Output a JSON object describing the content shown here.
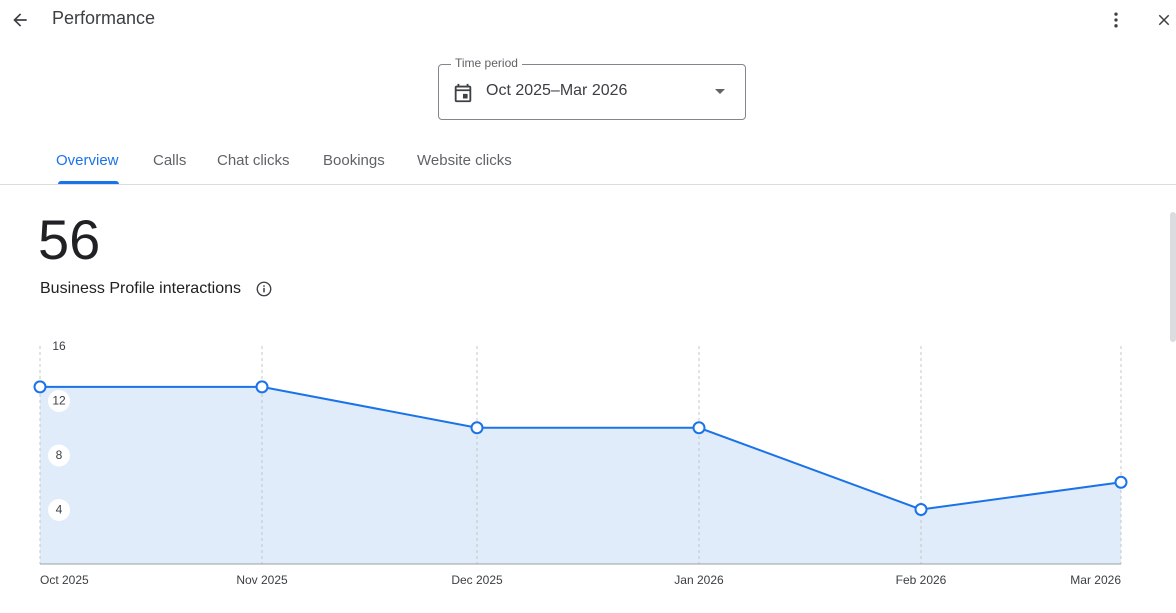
{
  "header": {
    "title": "Performance",
    "back_icon": "arrow-back-icon",
    "more_icon": "more-vert-icon",
    "close_icon": "close-icon"
  },
  "time_period": {
    "label": "Time period",
    "value": "Oct 2025–Mar 2026",
    "icon": "calendar-icon"
  },
  "tabs": [
    {
      "label": "Overview",
      "active": true
    },
    {
      "label": "Calls",
      "active": false
    },
    {
      "label": "Chat clicks",
      "active": false
    },
    {
      "label": "Bookings",
      "active": false
    },
    {
      "label": "Website clicks",
      "active": false
    }
  ],
  "metric": {
    "value": "56",
    "label": "Business Profile interactions",
    "info_icon": "info-icon"
  },
  "colors": {
    "accent": "#1a73e8",
    "area_fill": "#e1ecfb",
    "text": "#202124",
    "muted": "#5f6368"
  },
  "chart_data": {
    "type": "area",
    "x": [
      "Oct 2025",
      "Nov 2025",
      "Dec 2025",
      "Jan 2026",
      "Feb 2026",
      "Mar 2026"
    ],
    "y_ticks": [
      "16",
      "12",
      "8",
      "4"
    ],
    "series": [
      {
        "values": [
          13,
          13,
          10,
          10,
          4,
          6
        ]
      }
    ],
    "ylim": [
      0,
      16
    ],
    "grid": "vertical dashed"
  }
}
